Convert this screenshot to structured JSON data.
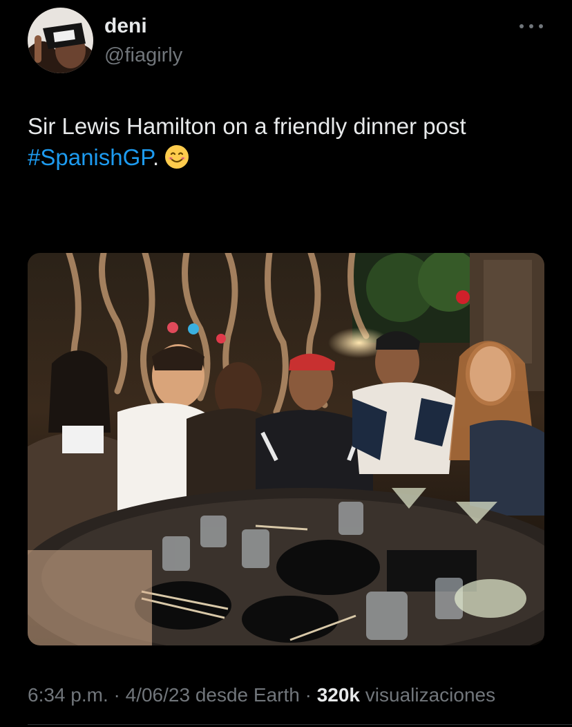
{
  "author": {
    "display_name": "deni",
    "handle": "@fiagirly",
    "avatar_icon": "avatar-photo"
  },
  "tweet": {
    "text_line1": "Sir Lewis Hamilton on a friendly dinner post",
    "hashtag": "#SpanishGP",
    "text_after_hashtag": ".",
    "emoji": "smiling-face-emoji",
    "media_icon": "group-dinner-photo"
  },
  "meta": {
    "time": "6:34 p.m.",
    "separator": "·",
    "date": "4/06/23",
    "source": "desde Earth",
    "views_count": "320k",
    "views_label": "visualizaciones"
  },
  "colors": {
    "background": "#000000",
    "text": "#e7e9ea",
    "secondary": "#71767b",
    "link": "#1d9bf0"
  }
}
